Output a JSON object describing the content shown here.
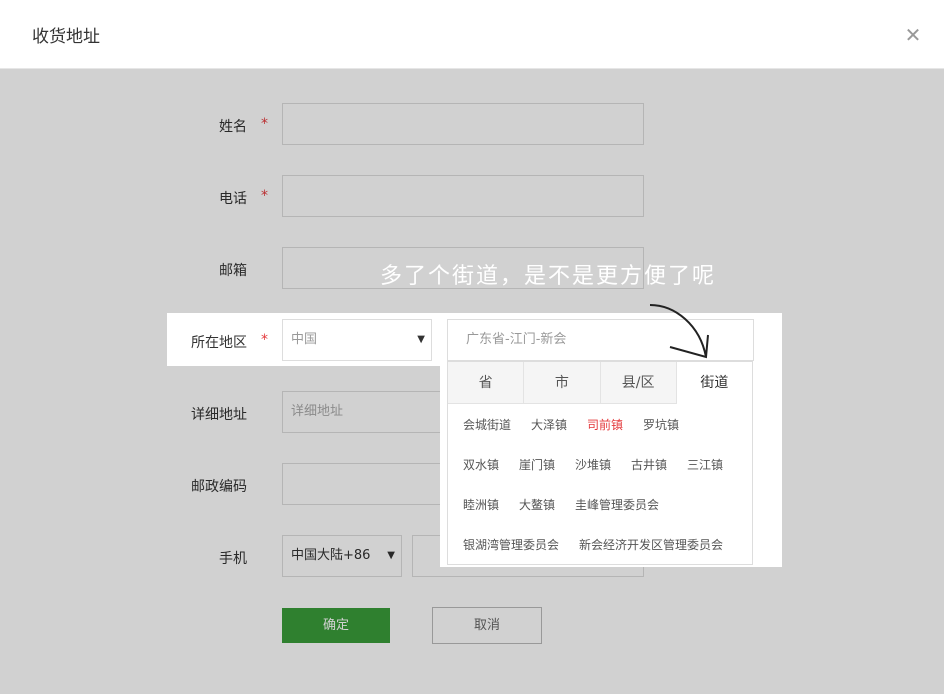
{
  "dialog": {
    "title": "收货地址"
  },
  "form": {
    "name_label": "姓名",
    "phone_label": "电话",
    "email_label": "邮箱",
    "region_label": "所在地区",
    "address_label": "详细地址",
    "address_placeholder": "详细地址",
    "postcode_label": "邮政编码",
    "mobile_label": "手机",
    "required_mark": "*",
    "country_value": "中国",
    "region_value": "广东省-江门-新会",
    "mobile_region_value": "中国大陆+86"
  },
  "region_picker": {
    "tabs": [
      "省",
      "市",
      "县/区",
      "街道"
    ],
    "active_tab": "街道",
    "towns": [
      "会城街道",
      "大泽镇",
      "司前镇",
      "罗坑镇",
      "双水镇",
      "崖门镇",
      "沙堆镇",
      "古井镇",
      "三江镇",
      "睦洲镇",
      "大鳌镇",
      "圭峰管理委员会",
      "银湖湾管理委员会",
      "新会经济开发区管理委员会"
    ],
    "selected_town": "司前镇"
  },
  "buttons": {
    "ok": "确定",
    "cancel": "取消"
  },
  "annotation": "多了个街道，是不是更方便了呢",
  "colors": {
    "accent_green": "#3a9d3a",
    "required_red": "#e4393c"
  }
}
